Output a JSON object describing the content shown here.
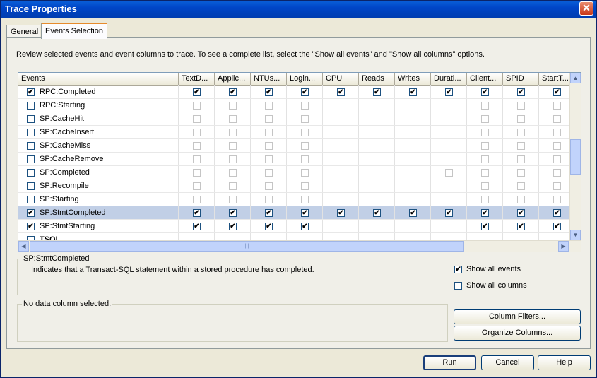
{
  "window": {
    "title": "Trace Properties",
    "close": "✕"
  },
  "tabs": [
    {
      "label": "General"
    },
    {
      "label": "Events Selection"
    }
  ],
  "instruction": "Review selected events and event columns to trace. To see a complete list, select the \"Show all events\" and \"Show all columns\" options.",
  "grid": {
    "columns": [
      "Events",
      "TextD...",
      "Applic...",
      "NTUs...",
      "Login...",
      "CPU",
      "Reads",
      "Writes",
      "Durati...",
      "Client...",
      "SPID",
      "StartT..."
    ],
    "rows": [
      {
        "name": "RPC:Completed",
        "checked": true,
        "cells": [
          "c",
          "c",
          "c",
          "c",
          "c",
          "c",
          "c",
          "c",
          "c",
          "c",
          "c"
        ]
      },
      {
        "name": "RPC:Starting",
        "checked": false,
        "cells": [
          "u",
          "u",
          "u",
          "u",
          "",
          "",
          "",
          "",
          "u",
          "u",
          "u"
        ]
      },
      {
        "name": "SP:CacheHit",
        "checked": false,
        "cells": [
          "u",
          "u",
          "u",
          "u",
          "",
          "",
          "",
          "",
          "u",
          "u",
          "u"
        ]
      },
      {
        "name": "SP:CacheInsert",
        "checked": false,
        "cells": [
          "u",
          "u",
          "u",
          "u",
          "",
          "",
          "",
          "",
          "u",
          "u",
          "u"
        ]
      },
      {
        "name": "SP:CacheMiss",
        "checked": false,
        "cells": [
          "u",
          "u",
          "u",
          "u",
          "",
          "",
          "",
          "",
          "u",
          "u",
          "u"
        ]
      },
      {
        "name": "SP:CacheRemove",
        "checked": false,
        "cells": [
          "u",
          "u",
          "u",
          "u",
          "",
          "",
          "",
          "",
          "u",
          "u",
          "u"
        ]
      },
      {
        "name": "SP:Completed",
        "checked": false,
        "cells": [
          "u",
          "u",
          "u",
          "u",
          "",
          "",
          "",
          "u",
          "u",
          "u",
          "u"
        ]
      },
      {
        "name": "SP:Recompile",
        "checked": false,
        "cells": [
          "u",
          "u",
          "u",
          "u",
          "",
          "",
          "",
          "",
          "u",
          "u",
          "u"
        ]
      },
      {
        "name": "SP:Starting",
        "checked": false,
        "cells": [
          "u",
          "u",
          "u",
          "u",
          "",
          "",
          "",
          "",
          "u",
          "u",
          "u"
        ]
      },
      {
        "name": "SP:StmtCompleted",
        "checked": true,
        "selected": true,
        "cells": [
          "c",
          "c",
          "c",
          "c",
          "c",
          "c",
          "c",
          "c",
          "c",
          "c",
          "c"
        ]
      },
      {
        "name": "SP:StmtStarting",
        "checked": true,
        "cells": [
          "c",
          "c",
          "c",
          "c",
          "",
          "",
          "",
          "",
          "c",
          "c",
          "c"
        ]
      },
      {
        "name": "TSQL",
        "checked": false,
        "cells": [
          "",
          "",
          "",
          "",
          "",
          "",
          "",
          "",
          "",
          "",
          ""
        ]
      }
    ]
  },
  "event_description": {
    "title": "SP:StmtCompleted",
    "text": "Indicates that a Transact-SQL statement within a stored procedure has completed."
  },
  "options": {
    "show_all_events": {
      "label": "Show all events",
      "checked": true
    },
    "show_all_columns": {
      "label": "Show all columns",
      "checked": false
    }
  },
  "column_info": {
    "text": "No data column selected."
  },
  "buttons": {
    "column_filters": "Column Filters...",
    "organize_columns": "Organize Columns...",
    "run": "Run",
    "cancel": "Cancel",
    "help": "Help"
  },
  "check_glyph": "✔"
}
